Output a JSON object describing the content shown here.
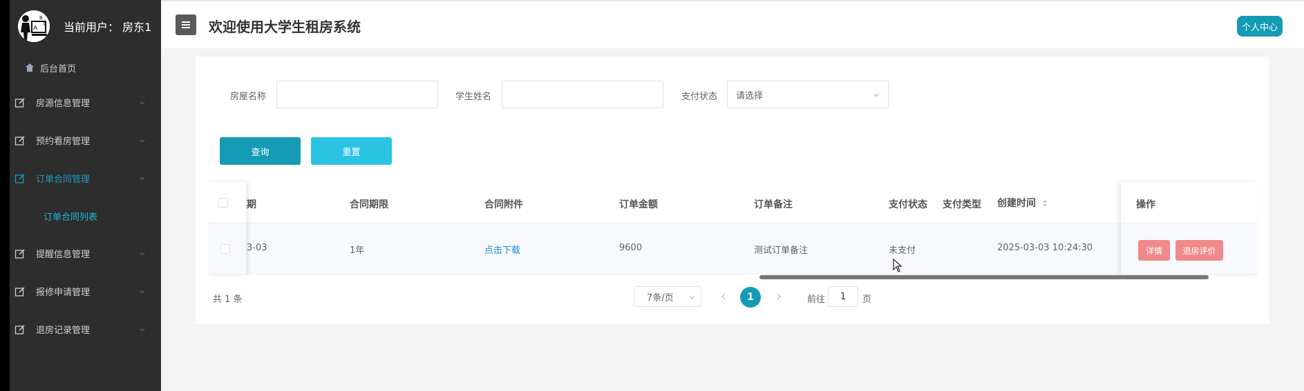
{
  "sidebar": {
    "current_user_label": "当前用户：",
    "current_user_name": "房东1",
    "home": {
      "label": "后台首页",
      "icon": "home-icon"
    },
    "items": [
      {
        "label": "房源信息管理",
        "icon": "edit-icon",
        "expanded": false
      },
      {
        "label": "预约看房管理",
        "icon": "edit-icon",
        "expanded": false
      },
      {
        "label": "订单合同管理",
        "icon": "edit-icon",
        "expanded": true,
        "active": true,
        "children": [
          {
            "label": "订单合同列表"
          }
        ]
      },
      {
        "label": "提醒信息管理",
        "icon": "edit-icon",
        "expanded": false
      },
      {
        "label": "报修申请管理",
        "icon": "edit-icon",
        "expanded": false
      },
      {
        "label": "退房记录管理",
        "icon": "edit-icon",
        "expanded": false
      }
    ]
  },
  "header": {
    "title": "欢迎使用大学生租房系统",
    "user_center": "个人中心"
  },
  "search": {
    "house_name_label": "房屋名称",
    "house_name_value": "",
    "student_name_label": "学生姓名",
    "student_name_value": "",
    "pay_status_label": "支付状态",
    "pay_status_placeholder": "请选择",
    "query_button": "查询",
    "reset_button": "重置"
  },
  "table": {
    "columns": [
      "期",
      "合同期限",
      "合同附件",
      "订单金额",
      "订单备注",
      "支付状态",
      "支付类型",
      "创建时间",
      "操作"
    ],
    "rows": [
      {
        "date_partial": "3-03",
        "contract_term": "1年",
        "attachment": "点击下载",
        "amount": "9600",
        "remark": "测试订单备注",
        "pay_status": "未支付",
        "pay_type": "",
        "created_at": "2025-03-03 10:24:30",
        "actions": [
          "详情",
          "退房评价"
        ]
      }
    ]
  },
  "pagination": {
    "total": "共 1 条",
    "page_size": "7条/页",
    "current_page": "1",
    "goto_label": "前往",
    "goto_value": "1",
    "goto_suffix": "页"
  },
  "colors": {
    "accent": "#159bb4",
    "accent_light": "#2ac3e4",
    "danger": "#f08a8a",
    "sidebar_bg": "#2d2d2d"
  }
}
